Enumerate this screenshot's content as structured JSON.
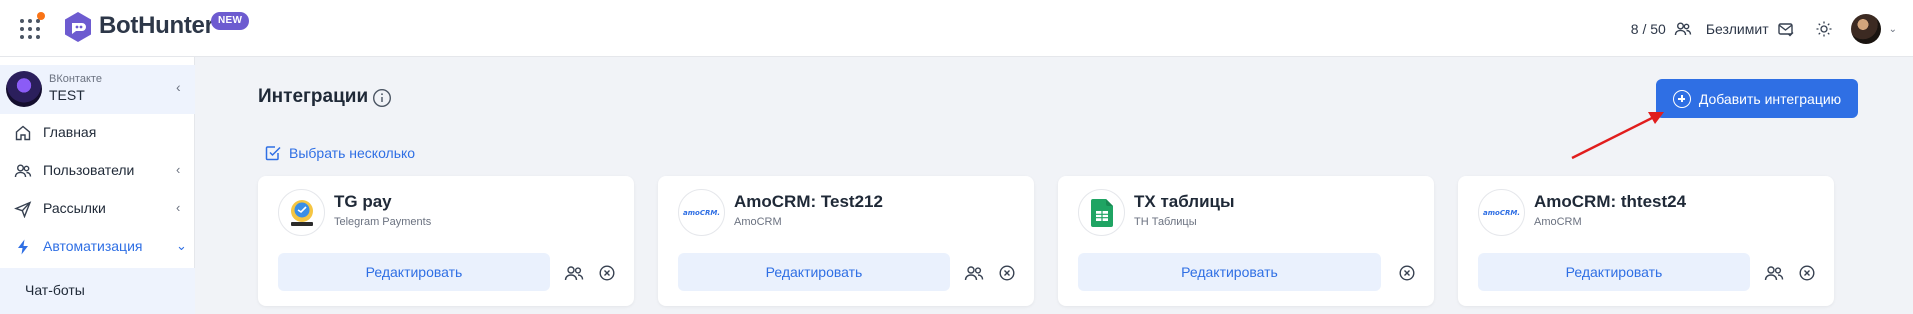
{
  "header": {
    "brand": "BotHunter",
    "badge": "NEW",
    "user_count": "8 / 50",
    "limit_label": "Безлимит"
  },
  "sidebar": {
    "account": {
      "network": "ВКонтакте",
      "name": "TEST"
    },
    "items": [
      {
        "label": "Главная"
      },
      {
        "label": "Пользователи"
      },
      {
        "label": "Рассылки"
      },
      {
        "label": "Автоматизация"
      }
    ],
    "subitem": "Чат-боты"
  },
  "main": {
    "title": "Интеграции",
    "add_button": "Добавить интеграцию",
    "select_multiple": "Выбрать несколько",
    "edit_label": "Редактировать",
    "cards": [
      {
        "title": "TG pay",
        "subtitle": "Telegram Payments",
        "logo": "tg-pay-logo",
        "users_icon": true
      },
      {
        "title": "AmoCRM: Test212",
        "subtitle": "AmoCRM",
        "logo": "amocrm-logo",
        "logo_text": "amoCRM.",
        "users_icon": true
      },
      {
        "title": "TX таблицы",
        "subtitle": "TH Таблицы",
        "logo": "google-sheets-logo",
        "users_icon": false
      },
      {
        "title": "AmoCRM: thtest24",
        "subtitle": "AmoCRM",
        "logo": "amocrm-logo",
        "logo_text": "amoCRM.",
        "users_icon": true
      }
    ]
  },
  "colors": {
    "accent": "#2f6fe4",
    "badge": "#6d5bd0",
    "notification_dot": "#f97316",
    "arrow": "#e11d1d"
  }
}
